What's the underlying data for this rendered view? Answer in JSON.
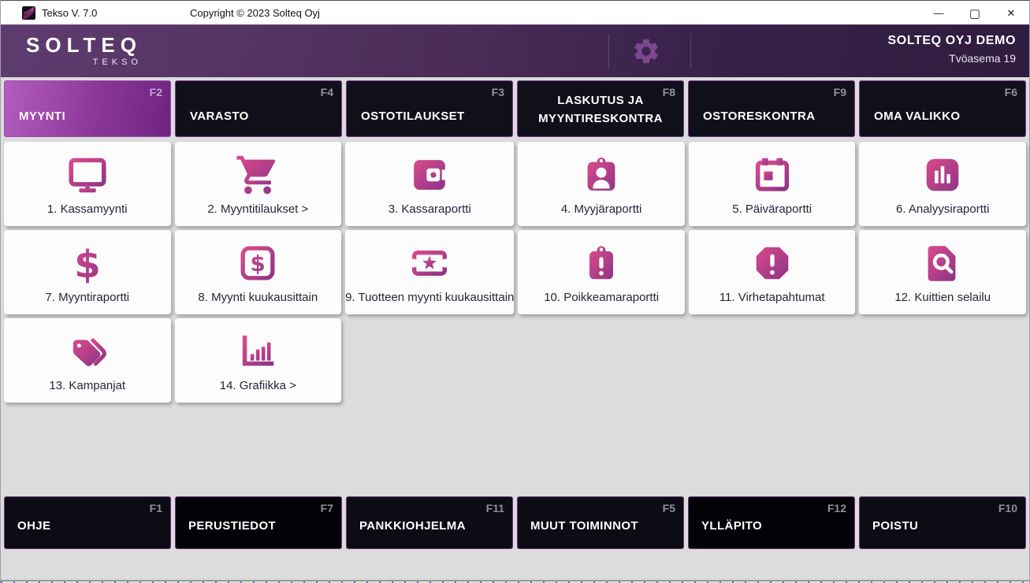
{
  "window": {
    "title": "Tekso V. 7.0",
    "copyright": "Copyright © 2023 Solteq Oyj",
    "controls": {
      "minimize": "—",
      "maximize": "▢",
      "close": "✕"
    }
  },
  "header": {
    "logo_primary": "SOLTEQ",
    "logo_secondary": "TEKSO",
    "company": "SOLTEQ OYJ DEMO",
    "workstation": "Tvöasema 19",
    "gear_icon": "gear-icon"
  },
  "tabs": [
    {
      "label": "MYYNTI",
      "fkey": "F2",
      "active": true
    },
    {
      "label": "VARASTO",
      "fkey": "F4",
      "active": false
    },
    {
      "label": "OSTOTILAUKSET",
      "fkey": "F3",
      "active": false
    },
    {
      "label": "LASKUTUS JA MYYNTIRESKONTRA",
      "fkey": "F8",
      "active": false
    },
    {
      "label": "OSTORESKONTRA",
      "fkey": "F9",
      "active": false
    },
    {
      "label": "OMA VALIKKO",
      "fkey": "F6",
      "active": false
    }
  ],
  "tiles": [
    {
      "label": "1. Kassamyynti",
      "icon": "monitor-icon"
    },
    {
      "label": "2. Myyntitilaukset >",
      "icon": "cart-icon"
    },
    {
      "label": "3. Kassaraportti",
      "icon": "wallet-icon"
    },
    {
      "label": "4. Myyjäraportti",
      "icon": "person-badge-icon"
    },
    {
      "label": "5. Päiväraportti",
      "icon": "calendar-icon"
    },
    {
      "label": "6. Analyysiraportti",
      "icon": "bar-chart-square-icon"
    },
    {
      "label": "7. Myyntiraportti",
      "icon": "dollar-icon"
    },
    {
      "label": "8. Myynti kuukausittain",
      "icon": "dollar-square-icon"
    },
    {
      "label": "9. Tuotteen myynti kuukausittain",
      "icon": "ticket-star-icon"
    },
    {
      "label": "10. Poikkeamaraportti",
      "icon": "exclamation-badge-icon"
    },
    {
      "label": "11. Virhetapahtumat",
      "icon": "exclamation-octagon-icon"
    },
    {
      "label": "12. Kuittien selailu",
      "icon": "document-search-icon"
    },
    {
      "label": "13. Kampanjat",
      "icon": "tags-icon"
    },
    {
      "label": "14. Grafiikka >",
      "icon": "bar-chart-axis-icon"
    }
  ],
  "bottom_buttons": [
    {
      "label": "OHJE",
      "fkey": "F1"
    },
    {
      "label": "PERUSTIEDOT",
      "fkey": "F7"
    },
    {
      "label": "PANKKIOHJELMA",
      "fkey": "F11"
    },
    {
      "label": "MUUT TOIMINNOT",
      "fkey": "F5"
    },
    {
      "label": "YLLÄPITO",
      "fkey": "F12"
    },
    {
      "label": "POISTU",
      "fkey": "F10"
    }
  ],
  "colors": {
    "header_gradient_start": "#5f3c70",
    "header_gradient_end": "#301c3e",
    "active_tab_start": "#b45cc0",
    "active_tab_end": "#6f2480",
    "icon_gradient_start": "#d94a8c",
    "icon_gradient_end": "#8f3486",
    "dark_button_bg": "#0c0c15",
    "tile_bg": "#fcfcfc",
    "content_bg": "#dcdcdc"
  }
}
